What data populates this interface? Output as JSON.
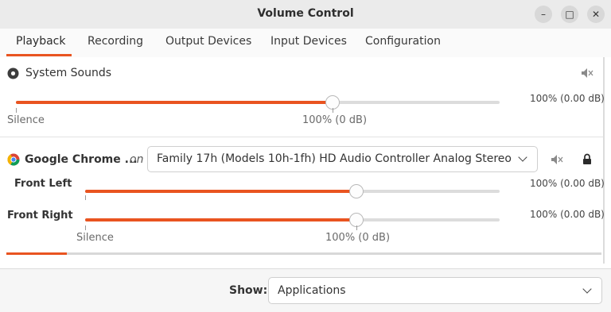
{
  "window": {
    "title": "Volume Control",
    "minimize": "–",
    "maximize": "□",
    "close": "✕"
  },
  "tabs": [
    {
      "label": "Playback",
      "active": true
    },
    {
      "label": "Recording"
    },
    {
      "label": "Output Devices"
    },
    {
      "label": "Input Devices"
    },
    {
      "label": "Configuration"
    }
  ],
  "system_sounds": {
    "label": "System Sounds",
    "volume_readout": "100% (0.00 dB)",
    "level_percent": 100,
    "scale_left": "Silence",
    "scale_mark": "100% (0 dB)",
    "mute_icon": "speaker-muted-icon"
  },
  "stream": {
    "app_name": "Google Chrome ...",
    "on_label": "on",
    "device": "Family 17h (Models 10h-1fh) HD Audio Controller Analog Stereo",
    "lock_icon": "lock-icon",
    "mute_icon": "speaker-muted-icon",
    "channels": [
      {
        "label": "Front Left",
        "readout": "100% (0.00 dB)",
        "level_percent": 100
      },
      {
        "label": "Front Right",
        "readout": "100% (0.00 dB)",
        "level_percent": 100
      }
    ],
    "scale_left": "Silence",
    "scale_mark": "100% (0 dB)",
    "peak_level_fraction": 0.1
  },
  "show": {
    "label": "Show:",
    "value": "Applications"
  },
  "colors": {
    "accent": "#e95420"
  }
}
